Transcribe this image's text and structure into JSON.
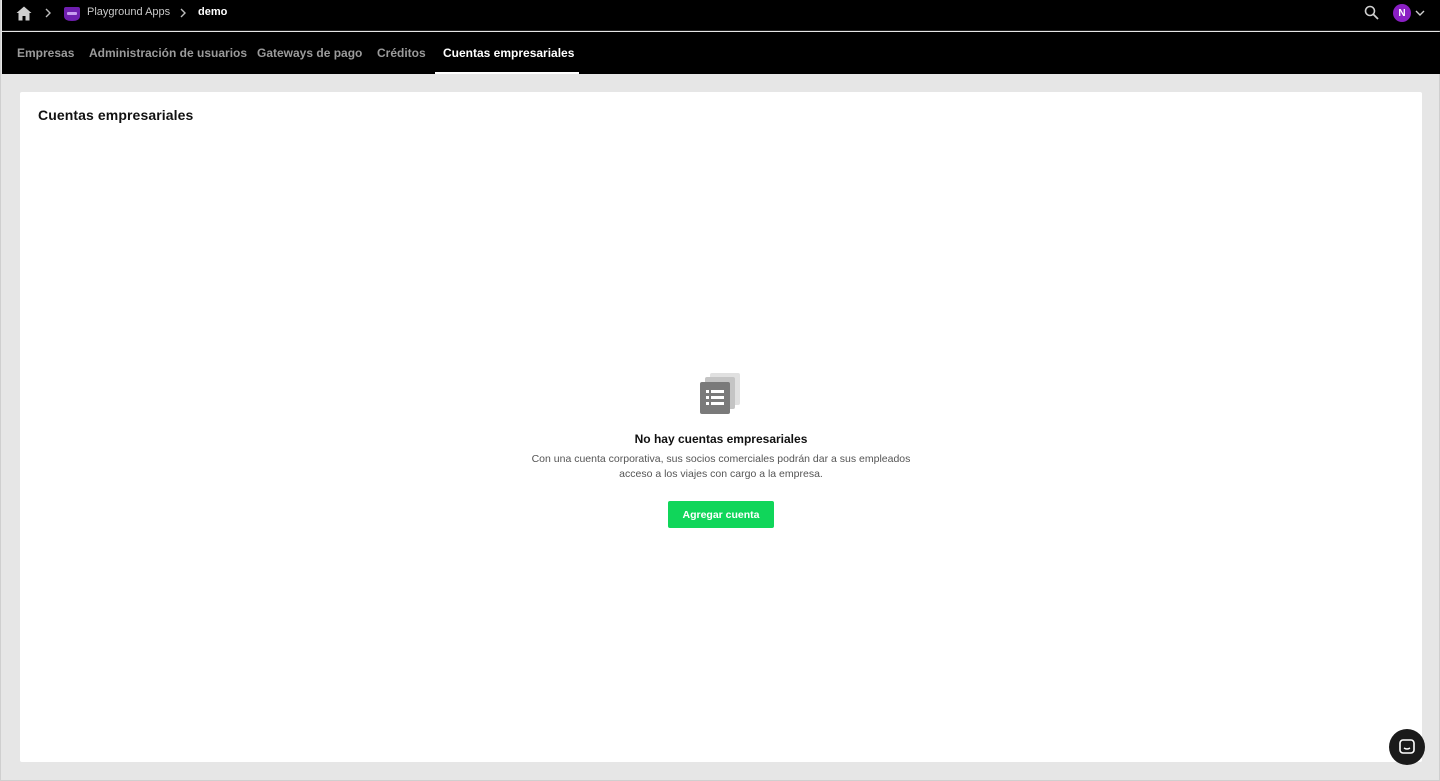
{
  "breadcrumb": {
    "app_name": "Playground Apps",
    "current": "demo"
  },
  "user": {
    "avatar_initial": "N"
  },
  "tabs": [
    {
      "label": "Empresas",
      "active": false
    },
    {
      "label": "Administración de usuarios",
      "active": false
    },
    {
      "label": "Gateways de pago",
      "active": false
    },
    {
      "label": "Créditos",
      "active": false
    },
    {
      "label": "Cuentas empresariales",
      "active": true
    }
  ],
  "main": {
    "title": "Cuentas empresariales",
    "empty_state": {
      "icon": "list-stack-icon",
      "title": "No hay cuentas empresariales",
      "description": "Con una cuenta corporativa, sus socios comerciales podrán dar a sus empleados acceso a los viajes con cargo a la empresa.",
      "button_label": "Agregar cuenta"
    }
  },
  "colors": {
    "accent_green": "#10d65a",
    "avatar_purple": "#8a1fc4",
    "bar_black": "#000000"
  },
  "icons": {
    "home": "home-icon",
    "search": "search-icon",
    "chevron": "chevron-right-icon",
    "chat": "chat-icon"
  }
}
